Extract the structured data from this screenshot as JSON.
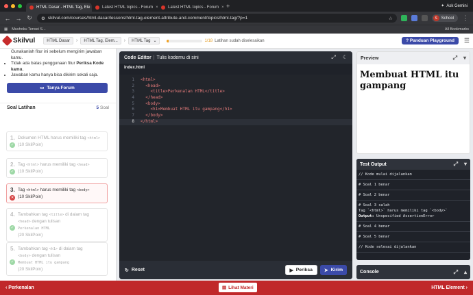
{
  "browser": {
    "tabs": [
      {
        "title": "HTML Dasar - HTML Tag, Ele",
        "active": true
      },
      {
        "title": "Latest HTML topics - Forum",
        "active": false
      },
      {
        "title": "Latest HTML topics - Forum",
        "active": false
      }
    ],
    "new_tab": "+",
    "gemini": "Ask Gemini",
    "url": "skilvul.com/courses/html-dasar/lessons/html-tag-element-attribute-and-comment/topics/html-tag/?p=1",
    "profile_initial": "S",
    "profile_label": "School",
    "bookmark": "Mushoku Tensei S...",
    "all_bookmarks": "All Bookmarks",
    "traffic_lights": [
      "#ff5f57",
      "#febc2e",
      "#28c840"
    ]
  },
  "header": {
    "logo_text": "Skilvul",
    "breadcrumbs": [
      "HTML Dasar",
      "HTML Tag, Elem...",
      "HTML Tag"
    ],
    "progress_count": "1/18",
    "progress_value": 0.055,
    "progress_text": "Latihan sudah diselesaikan",
    "panduan_label": "Panduan Playground"
  },
  "left": {
    "rules": [
      "Gunakanlah fitur ini sebelum mengirim jawaban kamu.",
      "Tidak ada batas penggunaan fitur",
      "Periksa Kode kamu.",
      "Jawaban kamu hanya bisa dikirim sekali saja."
    ],
    "forum_button": "Tanya Forum",
    "soal_title": "Soal Latihan",
    "soal_count": "5",
    "soal_count_label": "Soal",
    "items": [
      {
        "num": "1.",
        "a": "Dokumen HTML harus memiliki tag",
        "code": "<html>",
        "b": "",
        "pts": "(10 SkilPoin)",
        "status": "ok"
      },
      {
        "num": "2.",
        "a": "Tag",
        "code": "<html>",
        "b": "harus memiliki tag",
        "code2": "<head>",
        "pts": "(10 SkilPoin)",
        "status": "ok"
      },
      {
        "num": "3.",
        "a": "Tag",
        "code": "<html>",
        "b": "harus memiliki tag",
        "code2": "<body>",
        "pts": "(10 SkilPoin)",
        "status": "error"
      },
      {
        "num": "4.",
        "a": "Tambahkan tag",
        "code": "<title>",
        "b": "di dalam tag",
        "code2": "<head>",
        "c": "dengan tulisan",
        "code3": "Perkenalan HTML",
        "pts": "(20 SkilPoin)",
        "status": "ok"
      },
      {
        "num": "5.",
        "a": "Tambahkan tag",
        "code": "<h1>",
        "b": "di dalam tag",
        "code2": "<body>",
        "c": "dengan tulisan",
        "code3": "Membuat HTML itu gampang",
        "pts": "(20 SkilPoin)",
        "status": "ok"
      }
    ]
  },
  "editor": {
    "title": "Code Editor",
    "subtitle": "Tulis kodemu di sini",
    "filename": "index.html",
    "lines": [
      "<html>",
      "  <head>",
      "    <title>Perkenalan HTML</title>",
      "  </head>",
      "  <body>",
      "    <h1>Membuat HTML itu gampang</h1>",
      "  </body>",
      "</html>"
    ],
    "line_numbers": [
      "1",
      "2",
      "3",
      "4",
      "5",
      "6",
      "7",
      "8"
    ],
    "current_line": 8,
    "reset_label": "Reset",
    "periksa_label": "Periksa",
    "kirim_label": "Kirim"
  },
  "preview": {
    "title": "Preview",
    "h1_line1": "Membuat HTML itu",
    "h1_line2": "gampang"
  },
  "test_output": {
    "title": "Test Output",
    "lines": [
      {
        "text": "// Kode mulai dijalankan"
      },
      {
        "text": "# Soal 1 benar"
      },
      {
        "text": "# Soal 2 benar"
      },
      {
        "text": "# Soal 3 salah",
        "detail": "Tag `<html>` harus memiliki tag `<body>`",
        "output_label": "Output:",
        "output": "Unspecified AssertionError"
      },
      {
        "text": "# Soal 4 benar"
      },
      {
        "text": "# Soal 5 benar"
      },
      {
        "text": "// Kode selesai dijalankan"
      }
    ]
  },
  "console": {
    "title": "Console"
  },
  "footer": {
    "prev": "Perkenalan",
    "lihat": "Lihat Materi",
    "next": "HTML Element"
  }
}
